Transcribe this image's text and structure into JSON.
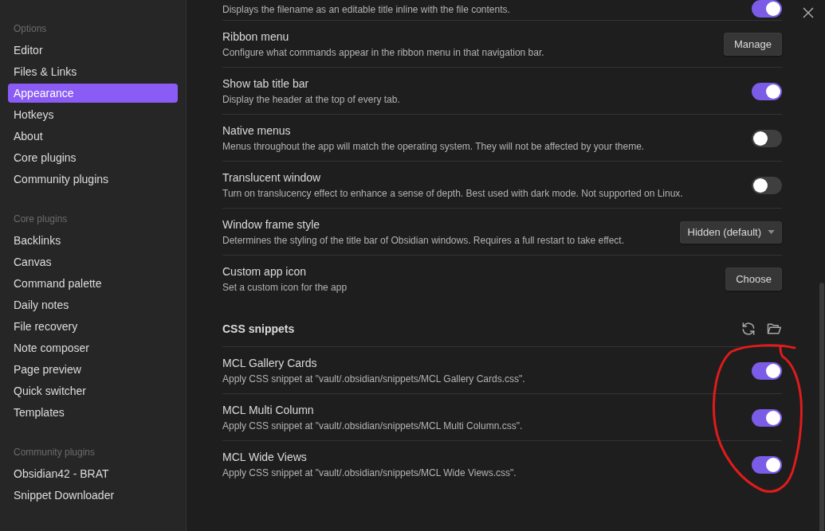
{
  "sidebar": {
    "sections": [
      {
        "heading": "Options",
        "items": [
          {
            "label": "Editor",
            "selected": false
          },
          {
            "label": "Files & Links",
            "selected": false
          },
          {
            "label": "Appearance",
            "selected": true
          },
          {
            "label": "Hotkeys",
            "selected": false
          },
          {
            "label": "About",
            "selected": false
          },
          {
            "label": "Core plugins",
            "selected": false
          },
          {
            "label": "Community plugins",
            "selected": false
          }
        ]
      },
      {
        "heading": "Core plugins",
        "items": [
          {
            "label": "Backlinks",
            "selected": false
          },
          {
            "label": "Canvas",
            "selected": false
          },
          {
            "label": "Command palette",
            "selected": false
          },
          {
            "label": "Daily notes",
            "selected": false
          },
          {
            "label": "File recovery",
            "selected": false
          },
          {
            "label": "Note composer",
            "selected": false
          },
          {
            "label": "Page preview",
            "selected": false
          },
          {
            "label": "Quick switcher",
            "selected": false
          },
          {
            "label": "Templates",
            "selected": false
          }
        ]
      },
      {
        "heading": "Community plugins",
        "items": [
          {
            "label": "Obsidian42 - BRAT",
            "selected": false
          },
          {
            "label": "Snippet Downloader",
            "selected": false
          }
        ]
      }
    ]
  },
  "settings": [
    {
      "description": "Displays the filename as an editable title inline with the file contents.",
      "control": {
        "kind": "toggle",
        "on": true
      }
    },
    {
      "title": "Ribbon menu",
      "description": "Configure what commands appear in the ribbon menu in that navigation bar.",
      "control": {
        "kind": "button",
        "label": "Manage"
      }
    },
    {
      "title": "Show tab title bar",
      "description": "Display the header at the top of every tab.",
      "control": {
        "kind": "toggle",
        "on": true
      }
    },
    {
      "title": "Native menus",
      "description": "Menus throughout the app will match the operating system. They will not be affected by your theme.",
      "control": {
        "kind": "toggle",
        "on": false
      }
    },
    {
      "title": "Translucent window",
      "description": "Turn on translucency effect to enhance a sense of depth. Best used with dark mode. Not supported on Linux.",
      "control": {
        "kind": "toggle",
        "on": false
      }
    },
    {
      "title": "Window frame style",
      "description": "Determines the styling of the title bar of Obsidian windows. Requires a full restart to take effect.",
      "control": {
        "kind": "dropdown",
        "value": "Hidden (default)"
      }
    },
    {
      "title": "Custom app icon",
      "description": "Set a custom icon for the app",
      "control": {
        "kind": "button",
        "label": "Choose"
      }
    }
  ],
  "css_snippets": {
    "heading": "CSS snippets",
    "items": [
      {
        "title": "MCL Gallery Cards",
        "description": "Apply CSS snippet at \"vault/.obsidian/snippets/MCL Gallery Cards.css\".",
        "on": true
      },
      {
        "title": "MCL Multi Column",
        "description": "Apply CSS snippet at \"vault/.obsidian/snippets/MCL Multi Column.css\".",
        "on": true
      },
      {
        "title": "MCL Wide Views",
        "description": "Apply CSS snippet at \"vault/.obsidian/snippets/MCL Wide Views.css\".",
        "on": true
      }
    ]
  }
}
